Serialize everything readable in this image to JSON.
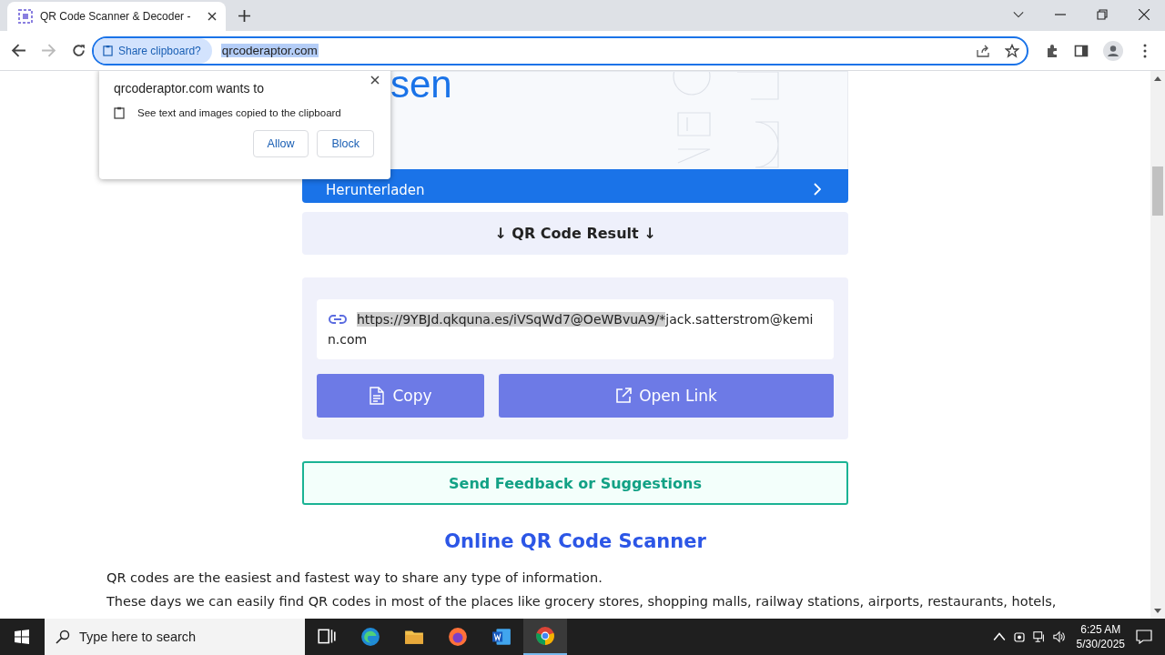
{
  "browser": {
    "tab_title": "QR Code Scanner & Decoder -",
    "chip": "Share clipboard?",
    "url": "qrcoderaptor.com",
    "url_selected": true
  },
  "permission_popup": {
    "title": "qrcoderaptor.com wants to",
    "permission": "See text and images copied to the clipboard",
    "buttons": [
      "Allow",
      "Block"
    ]
  },
  "page": {
    "banner_text": "sen",
    "download_bar": "Herunterladen",
    "result_heading": "↓ QR Code Result ↓",
    "result": {
      "selected_text": "https://9YBJd.qkquna.es/iVSqWd7@OeWBvuA9/*",
      "rest_text": "jack.satterstrom@kemin.com"
    },
    "buttons": [
      {
        "kind": "copy",
        "label": "Copy"
      },
      {
        "kind": "open",
        "label": "Open Link"
      }
    ],
    "feedback": "Send Feedback or Suggestions",
    "heading": "Online QR Code Scanner",
    "paragraphs": [
      "QR codes are the easiest and fastest way to share any type of information.",
      "These days we can easily find QR codes in most of the places like grocery stores, shopping malls, railway stations, airports, restaurants, hotels,"
    ]
  },
  "taskbar": {
    "search_placeholder": "Type here to search",
    "apps": [
      {
        "kind": "taskview",
        "selected": false
      },
      {
        "kind": "edge",
        "selected": false
      },
      {
        "kind": "explorer",
        "selected": false
      },
      {
        "kind": "firefox",
        "selected": false
      },
      {
        "kind": "word",
        "selected": false
      },
      {
        "kind": "chrome",
        "selected": true
      }
    ],
    "time": "6:25 AM",
    "date": "5/30/2025"
  }
}
